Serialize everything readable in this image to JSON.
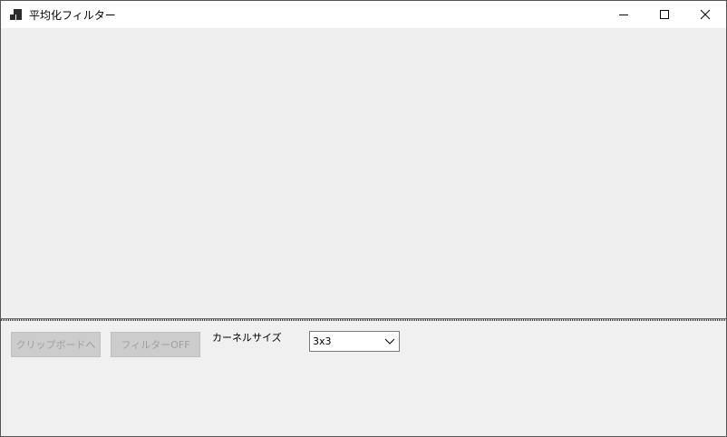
{
  "window": {
    "title": "平均化フィルター",
    "icons": {
      "app": "app-window-icon",
      "minimize": "minimize-icon",
      "maximize": "maximize-icon",
      "close": "close-icon"
    }
  },
  "controls": {
    "clipboard_button": "クリップボードへ",
    "filter_button": "フィルターOFF",
    "buttons_enabled": false,
    "kernel_label": "カーネルサイズ",
    "kernel_size": {
      "selected": "3x3",
      "dropdown_icon": "chevron-down-icon"
    }
  },
  "colors": {
    "background": "#f0f0f0",
    "titlebar": "#ffffff",
    "disabled_button": "#cccccc",
    "disabled_text": "#a0a0a0"
  }
}
